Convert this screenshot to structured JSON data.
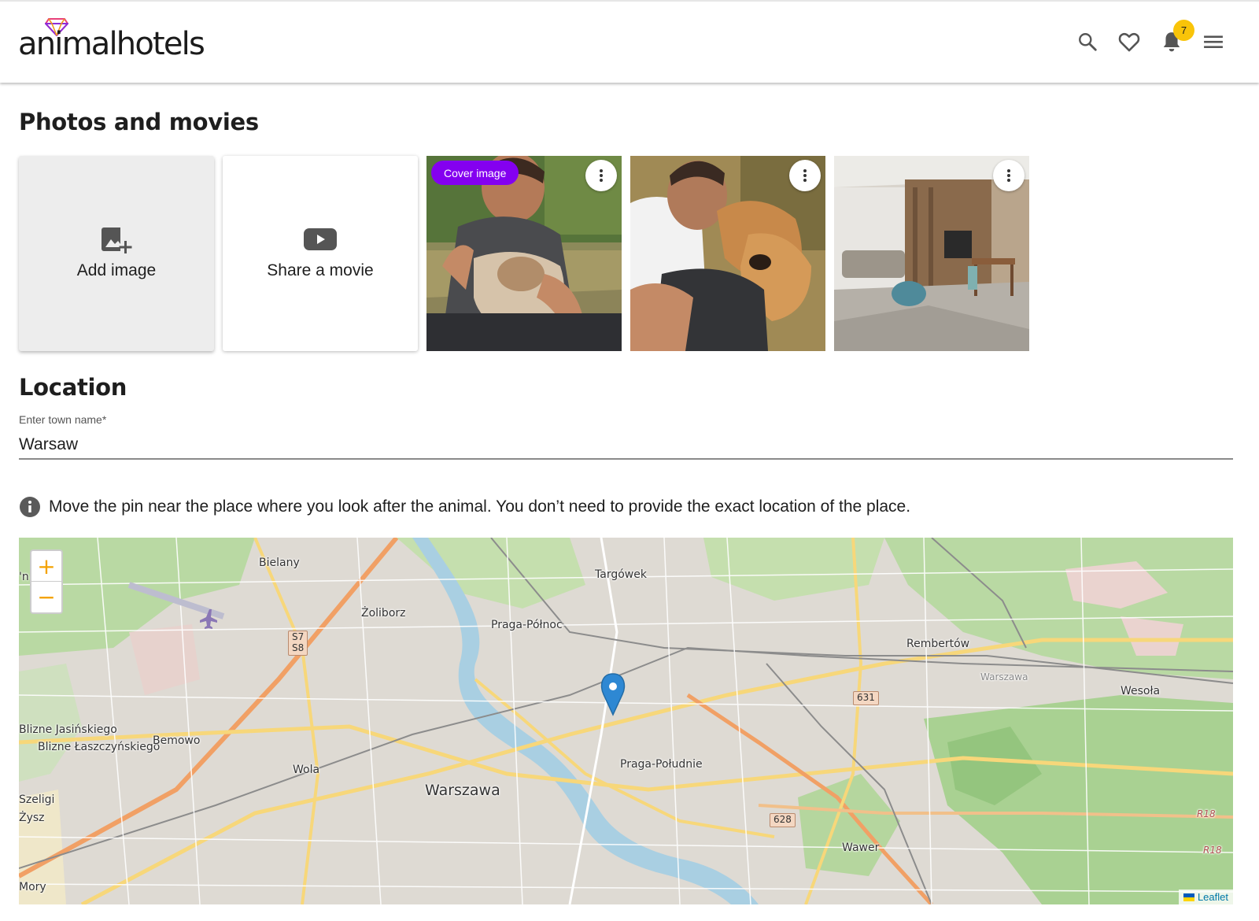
{
  "header": {
    "logo_text": "animalhotels",
    "notifications_count": "7",
    "icons": [
      "search-icon",
      "heart-icon",
      "bell-icon",
      "menu-icon"
    ],
    "accent": "#f9c409"
  },
  "photos": {
    "title": "Photos and movies",
    "add_image_label": "Add image",
    "share_movie_label": "Share a movie",
    "cover_badge_label": "Cover image",
    "cover_color": "#8400f0"
  },
  "location": {
    "title": "Location",
    "town_label": "Enter town name*",
    "town_value": "Warsaw",
    "info_text": "Move the pin near the place where you look after the animal. You don’t need to provide the exact location of the place."
  },
  "map": {
    "zoom_in": "+",
    "zoom_out": "−",
    "attribution": "Leaflet",
    "labels": {
      "bielany": "Bielany",
      "targowek": "Targówek",
      "zoliborz": "Żoliborz",
      "praga_polnoc": "Praga-Północ",
      "rembertow": "Rembertów",
      "warszawa_rail": "Warszawa",
      "wesola": "Wesoła",
      "blizne_jas": "Blizne Jasińskiego",
      "blizne_lasz": "Blizne Łaszczyńskiego",
      "bemowo": "Bemowo",
      "wola": "Wola",
      "praga_poludnie": "Praga-Południe",
      "warszawa": "Warszawa",
      "szeligi": "Szeligi",
      "ozarow": "Żysz",
      "wawer": "Wawer",
      "mory": "Mory",
      "left_n": "'n"
    },
    "shields": {
      "s7": "S7",
      "s8": "S8",
      "r631": "631",
      "r628": "628",
      "r18a": "R18",
      "r18b": "R18"
    }
  }
}
